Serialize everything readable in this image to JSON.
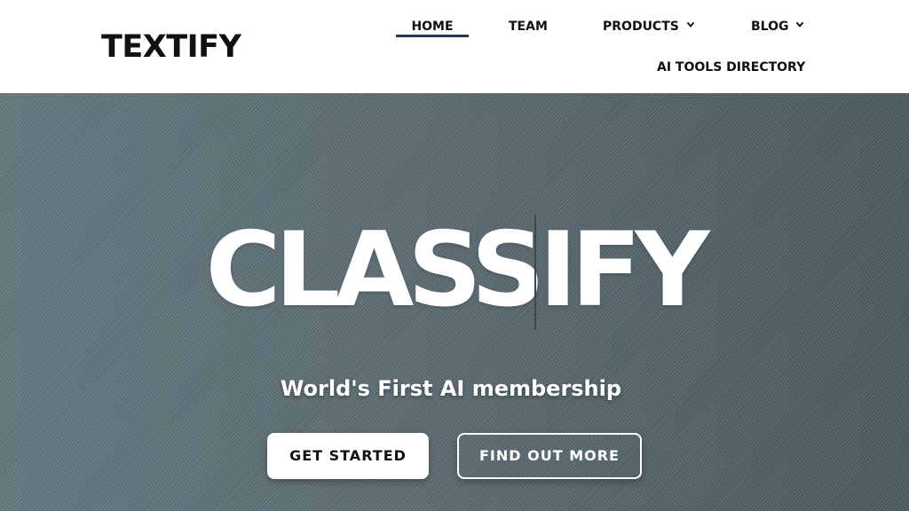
{
  "brand": {
    "logo": "TEXTIFY"
  },
  "nav": {
    "home": "HOME",
    "team": "TEAM",
    "products": "PRODUCTS",
    "blog": "BLOG",
    "ai_tools": "AI TOOLS DIRECTORY"
  },
  "hero": {
    "title": "CLASSIFY",
    "subtitle": "World's First AI membership",
    "primary_button": "GET STARTED",
    "secondary_button": "FIND OUT MORE"
  },
  "colors": {
    "nav_active_underline": "#1d3e52",
    "hero_background": "#5e6f76",
    "text_dark": "#111111",
    "text_light": "#ffffff"
  },
  "icons": {
    "dropdown": "chevron-down-icon"
  }
}
